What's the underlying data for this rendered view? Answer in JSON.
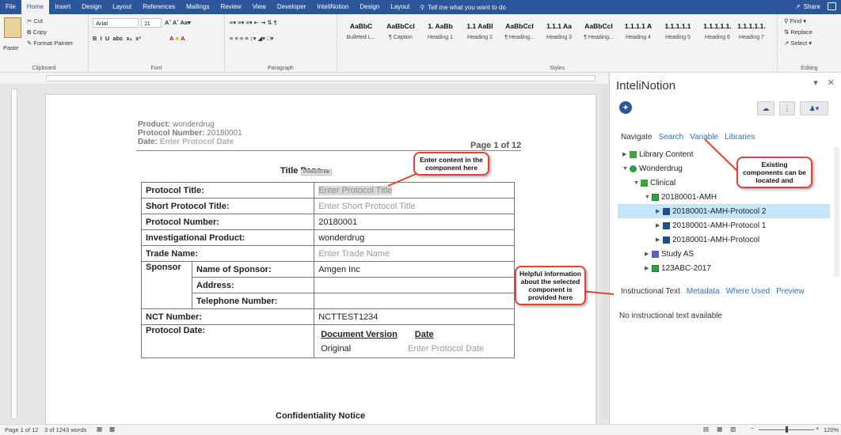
{
  "tabs": [
    "File",
    "Home",
    "Insert",
    "Design",
    "Layout",
    "References",
    "Mailings",
    "Review",
    "View",
    "Developer",
    "InteliNotion",
    "Design",
    "Layout"
  ],
  "tell_me": "Tell me what you want to do",
  "share": "Share",
  "ribbon": {
    "clipboard": {
      "cut": "Cut",
      "copy": "Copy",
      "paste": "Paste",
      "format_painter": "Format Painter",
      "label": "Clipboard"
    },
    "font": {
      "name": "Arial",
      "size": "11",
      "label": "Font"
    },
    "paragraph": {
      "label": "Paragraph"
    },
    "styles": {
      "label": "Styles",
      "items": [
        {
          "preview": "AaBbC",
          "name": "Bulleted L..."
        },
        {
          "preview": "AaBbCcI",
          "name": "¶ Caption"
        },
        {
          "preview": "1. AaBb",
          "name": "Heading 1"
        },
        {
          "preview": "1.1 AaBl",
          "name": "Heading 2"
        },
        {
          "preview": "AaBbCcI",
          "name": "¶ Heading..."
        },
        {
          "preview": "1.1.1 Aa",
          "name": "Heading 3"
        },
        {
          "preview": "AaBbCcI",
          "name": "¶ Heading..."
        },
        {
          "preview": "1.1.1.1 A",
          "name": "Heading 4"
        },
        {
          "preview": "1.1.1.1.1",
          "name": "Heading 5"
        },
        {
          "preview": "1.1.1.1.1.",
          "name": "Heading 6"
        },
        {
          "preview": "1.1.1.1.1.",
          "name": "Heading 7"
        }
      ]
    },
    "editing": {
      "find": "Find",
      "replace": "Replace",
      "select": "Select",
      "label": "Editing"
    }
  },
  "document": {
    "header": {
      "product_label": "Product:",
      "product": "wonderdrug",
      "protocol_label": "Protocol Number:",
      "protocol": "20180001",
      "date_label": "Date:",
      "date_placeholder": "Enter Protocol Date",
      "page_of": "Page 1 of 12"
    },
    "title_page": "Title Page",
    "component_tag": "ProtocolTitle",
    "rows": [
      {
        "label": "Protocol Title:",
        "value": "Enter Protocol Title"
      },
      {
        "label": "Short Protocol Title:",
        "value": "Enter Short Protocol Title"
      },
      {
        "label": "Protocol Number:",
        "value": "20180001"
      },
      {
        "label": "Investigational Product:",
        "value": "wonderdrug"
      },
      {
        "label": "Trade Name:",
        "value": "Enter Trade Name"
      }
    ],
    "sponsor": {
      "label": "Sponsor",
      "name_label": "Name of Sponsor:",
      "name": "Amgen Inc",
      "address_label": "Address:",
      "phone_label": "Telephone Number:"
    },
    "nct": {
      "label": "NCT Number:",
      "value": "NCTTEST1234"
    },
    "protocol_date": {
      "label": "Protocol Date:",
      "col1": "Document Version",
      "col2": "Date",
      "v1": "Original",
      "v2": "Enter Protocol Date"
    },
    "confidentiality": "Confidentiality Notice"
  },
  "pane": {
    "title": "InteliNotion",
    "nav_tabs": [
      "Navigate",
      "Search",
      "Variable",
      "Libraries"
    ],
    "tree": [
      {
        "label": "Library Content",
        "indent": 0
      },
      {
        "label": "Wonderdrug",
        "indent": 0
      },
      {
        "label": "Clinical",
        "indent": 1
      },
      {
        "label": "20180001-AMH",
        "indent": 2
      },
      {
        "label": "20180001-AMH-Protocol 2",
        "indent": 3,
        "selected": true
      },
      {
        "label": "20180001-AMH-Protocol 1",
        "indent": 3
      },
      {
        "label": "20180001-AMH-Protocol",
        "indent": 3
      },
      {
        "label": "Study AS",
        "indent": 2
      },
      {
        "label": "123ABC-2017",
        "indent": 2
      }
    ],
    "bottom_tabs": [
      "Instructional Text",
      "Metadata",
      "Where Used",
      "Preview"
    ],
    "instructional_text": "No instructional text available"
  },
  "callouts": {
    "enter_content": "Enter content in the component here",
    "existing": "Existing components can be located and",
    "helpful": "Helpful information about the selected component is provided here"
  },
  "status": {
    "page": "Page 1 of 12",
    "words": "3 of 1243 words",
    "zoom": "120%"
  }
}
